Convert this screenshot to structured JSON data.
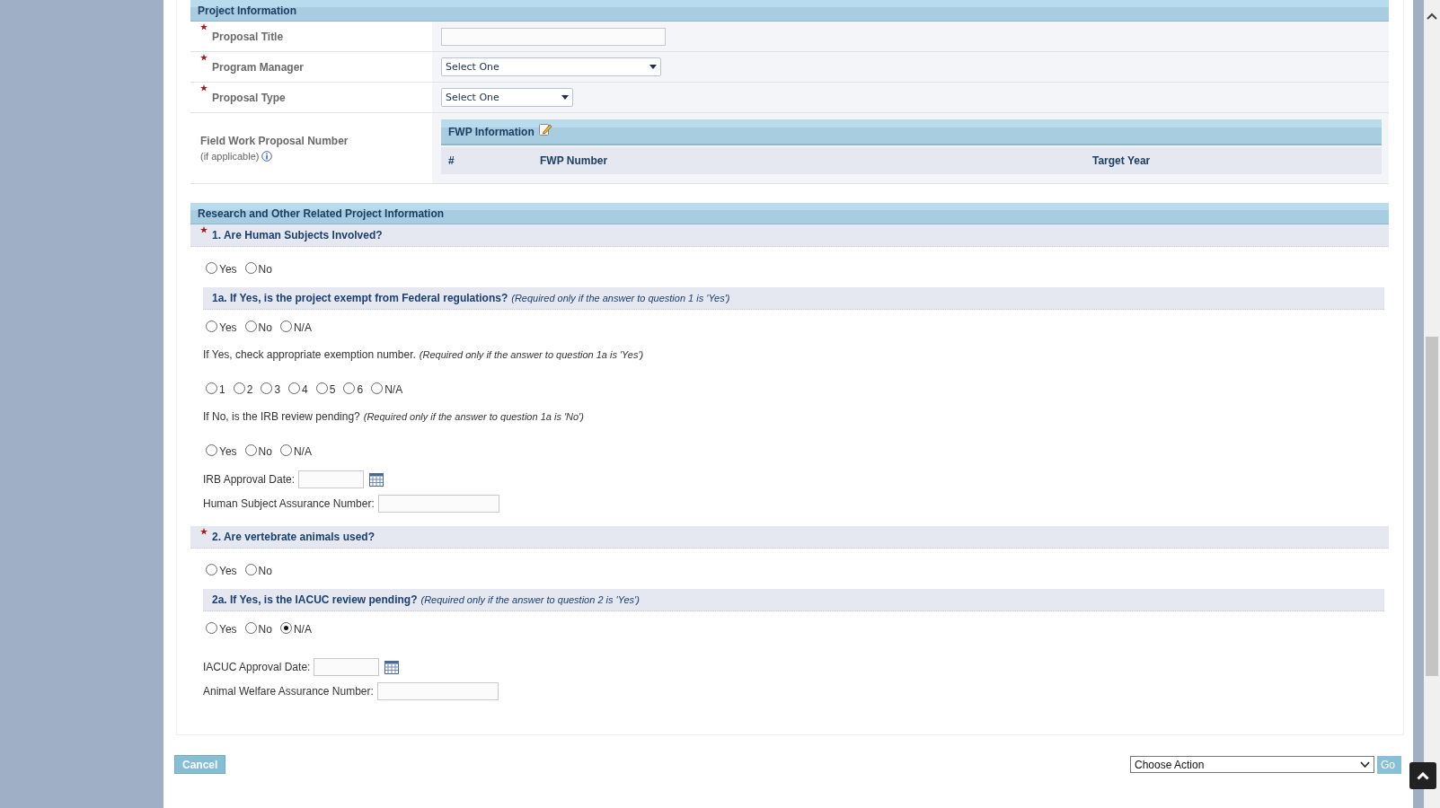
{
  "project_information": {
    "title": "Project Information",
    "rows": [
      {
        "kind": "text",
        "label": "Proposal Title",
        "required": true
      },
      {
        "kind": "select",
        "label": "Program Manager",
        "required": true,
        "value": "Select One"
      },
      {
        "kind": "select",
        "label": "Proposal Type",
        "required": true,
        "value": "Select One"
      },
      {
        "kind": "fwp",
        "label": "Field Work Proposal Number",
        "required": false,
        "note": "(if applicable)",
        "table": {
          "title": "FWP Information",
          "columns": [
            "#",
            "FWP Number",
            "Target Year"
          ]
        }
      }
    ]
  },
  "research": {
    "title": "Research and Other Related Project Information",
    "items": [
      {
        "kind": "question",
        "required": true,
        "text": "1. Are Human Subjects Involved?"
      },
      {
        "kind": "radios",
        "options": [
          {
            "label": "Yes",
            "selected": false
          },
          {
            "label": "No",
            "selected": false
          }
        ]
      },
      {
        "kind": "subquestion",
        "text": "1a. If Yes, is the project exempt from Federal regulations?",
        "note": "(Required only if the answer to question 1 is 'Yes')"
      },
      {
        "kind": "radios",
        "options": [
          {
            "label": "Yes",
            "selected": false
          },
          {
            "label": "No",
            "selected": false
          },
          {
            "label": "N/A",
            "selected": false
          }
        ]
      },
      {
        "kind": "instruction",
        "text": "If Yes, check appropriate exemption number.",
        "note": "(Required only if the answer to question 1a is 'Yes')"
      },
      {
        "kind": "radios",
        "options": [
          {
            "label": "1",
            "selected": false
          },
          {
            "label": "2",
            "selected": false
          },
          {
            "label": "3",
            "selected": false
          },
          {
            "label": "4",
            "selected": false
          },
          {
            "label": "5",
            "selected": false
          },
          {
            "label": "6",
            "selected": false
          },
          {
            "label": "N/A",
            "selected": false
          }
        ]
      },
      {
        "kind": "instruction",
        "text": "If No, is the IRB review pending?",
        "note": "(Required only if the answer to question 1a is 'No')"
      },
      {
        "kind": "radios",
        "options": [
          {
            "label": "Yes",
            "selected": false
          },
          {
            "label": "No",
            "selected": false
          },
          {
            "label": "N/A",
            "selected": false
          }
        ]
      },
      {
        "kind": "date_field",
        "label": "IRB Approval Date:"
      },
      {
        "kind": "text_field",
        "label": "Human Subject Assurance Number:"
      },
      {
        "kind": "question",
        "required": true,
        "text": "2. Are vertebrate animals used?"
      },
      {
        "kind": "radios",
        "options": [
          {
            "label": "Yes",
            "selected": false
          },
          {
            "label": "No",
            "selected": false
          }
        ]
      },
      {
        "kind": "subquestion",
        "text": "2a. If Yes, is the IACUC review pending?",
        "note": "(Required only if the answer to question 2 is 'Yes')"
      },
      {
        "kind": "radios",
        "options": [
          {
            "label": "Yes",
            "selected": false
          },
          {
            "label": "No",
            "selected": false
          },
          {
            "label": "N/A",
            "selected": true
          }
        ]
      },
      {
        "kind": "date_field",
        "label": "IACUC Approval Date:"
      },
      {
        "kind": "text_field",
        "label": "Animal Welfare Assurance Number:"
      }
    ]
  },
  "footer": {
    "cancel": "Cancel",
    "action": "Choose Action",
    "go": "Go"
  }
}
